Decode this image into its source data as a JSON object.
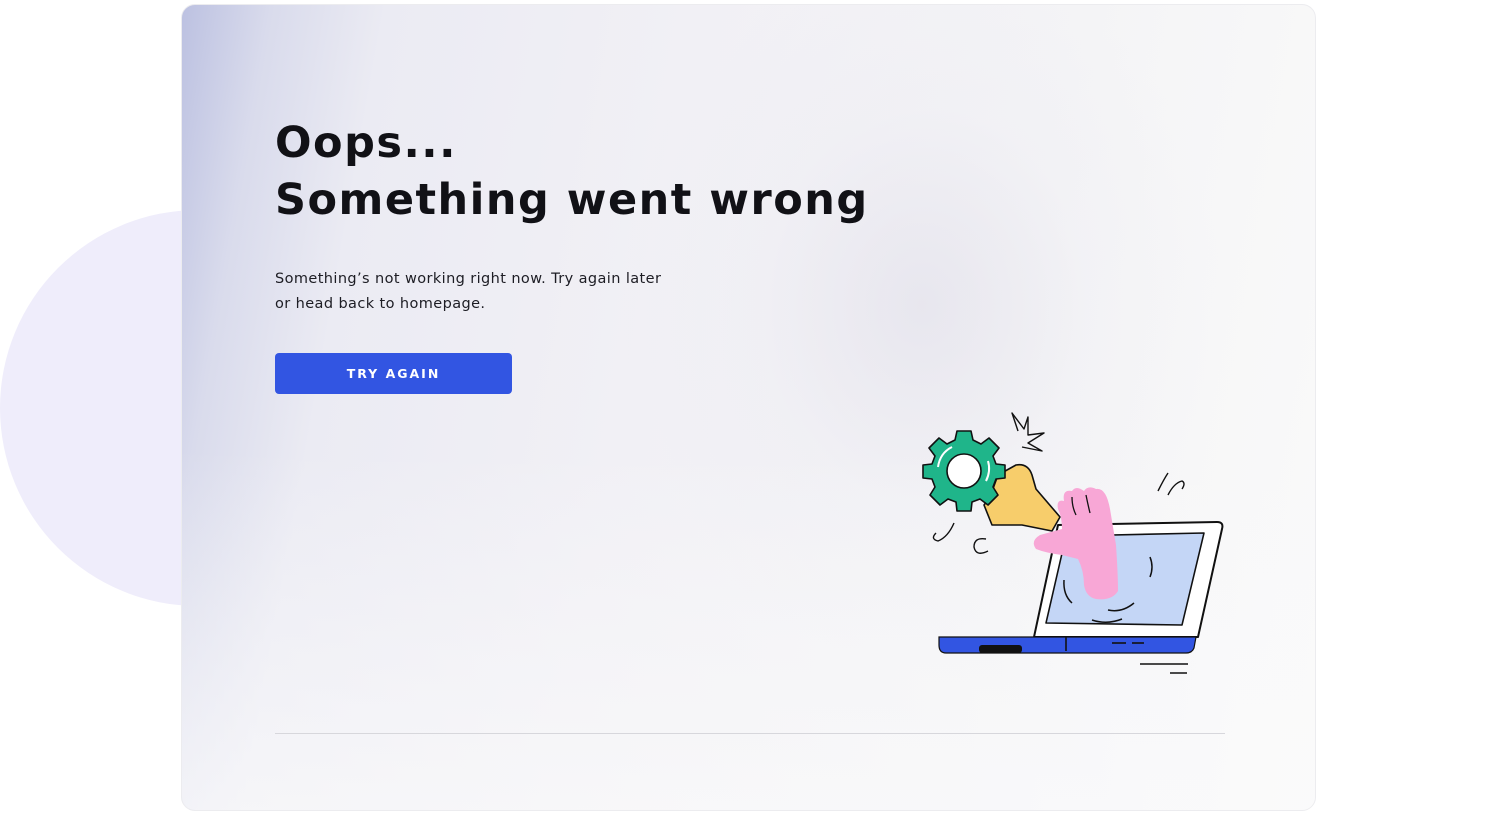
{
  "error": {
    "title_line1": "Oops...",
    "title_line2": "Something went wrong",
    "message": "Something’s not working right now. Try again later or head back to homepage.",
    "retry_label": "TRY AGAIN"
  },
  "illustration": {
    "icon": "broken-laptop-repair-icon",
    "colors": {
      "gear": "#1fb58a",
      "wrench": "#f7cd6b",
      "hand": "#f8a7d6",
      "screen": "#c4d6f6",
      "laptop_base": "#3255e2"
    }
  },
  "colors": {
    "accent": "#3255e2",
    "background_circle": "#efedfb"
  }
}
